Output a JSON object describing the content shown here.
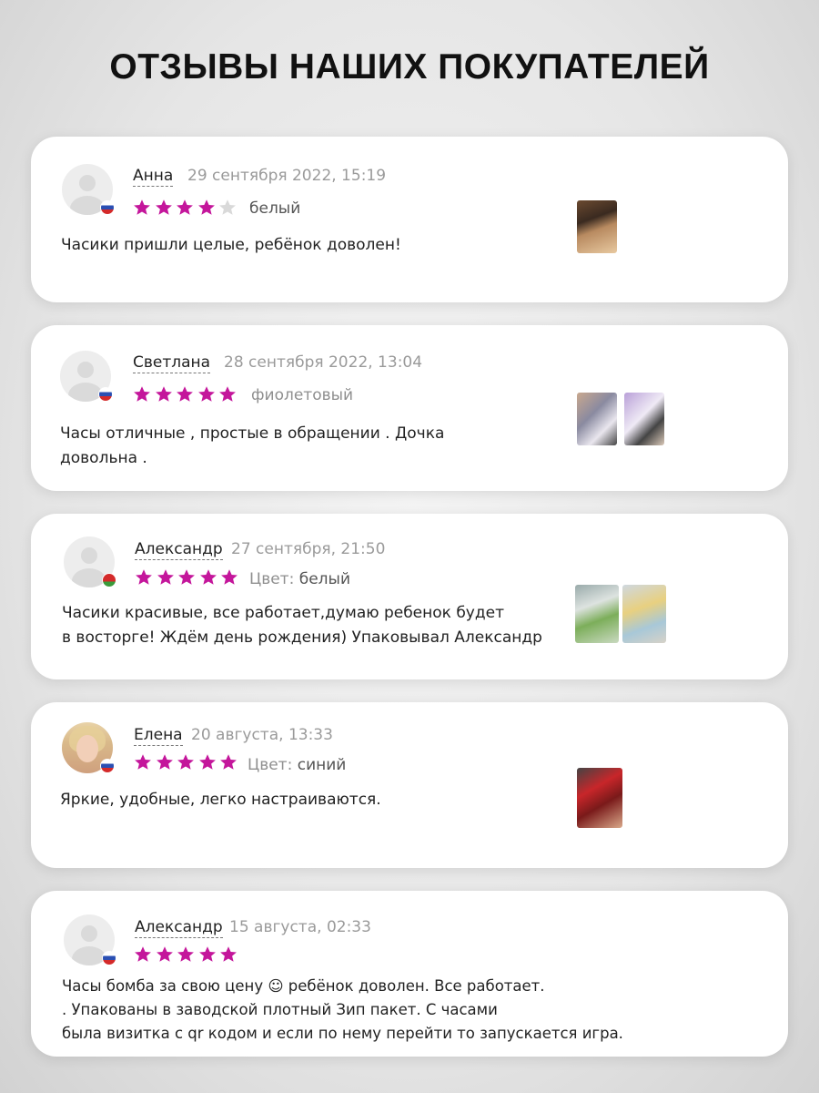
{
  "page_title": "ОТЗЫВЫ НАШИХ ПОКУПАТЕЛЕЙ",
  "colors": {
    "star_filled": "#c4169b",
    "star_empty": "#d9d9d9"
  },
  "reviews": [
    {
      "name": "Анна",
      "date": "29 сентября 2022, 15:19",
      "rating": 4,
      "variant_label": "",
      "variant_value": "белый",
      "text": "Часики пришли целые, ребёнок доволен!",
      "flag": "ru-flag-icon",
      "photos": 1
    },
    {
      "name": "Светлана",
      "date": "28 сентября 2022, 13:04",
      "rating": 5,
      "variant_label": "",
      "variant_value": "фиолетовый",
      "text": "Часы отличные , простые в обращении . Дочка\nдовольна .",
      "flag": "ru-flag-icon",
      "photos": 2
    },
    {
      "name": "Александр",
      "date": "27 сентября, 21:50",
      "rating": 5,
      "variant_label": "Цвет: ",
      "variant_value": "белый",
      "text": "Часики красивые, все работает,думаю ребенок будет\n в восторге! Ждём день рождения) Упаковывал Александр",
      "flag": "by-flag-icon",
      "photos": 2
    },
    {
      "name": "Елена",
      "date": "20 августа, 13:33",
      "rating": 5,
      "variant_label": "Цвет: ",
      "variant_value": "синий",
      "text": "Яркие, удобные, легко настраиваются.",
      "flag": "ru-flag-icon",
      "photos": 1
    },
    {
      "name": "Александр",
      "date": "15 августа, 02:33",
      "rating": 5,
      "variant_label": "",
      "variant_value": "",
      "text": "Часы бомба за свою цену ☺ ребёнок доволен. Все работает.\n. Упакованы в заводской плотный Зип пакет. С часами\nбыла визитка с qr кодом и если по нему перейти то запускается игра.",
      "flag": "ru-flag-icon",
      "photos": 0
    }
  ]
}
